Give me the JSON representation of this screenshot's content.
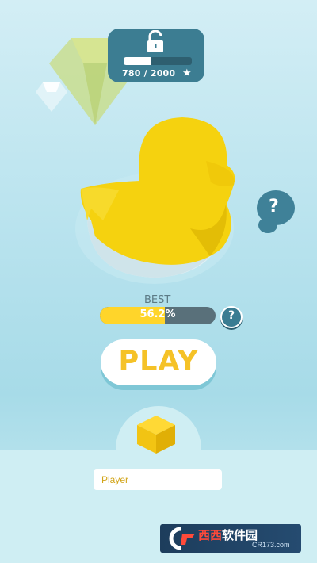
{
  "unlock": {
    "progress_text": "780 / 2000",
    "progress_current": 780,
    "progress_total": 2000,
    "star_icon": "star-icon",
    "lock_icon": "unlocked-padlock-icon"
  },
  "help": {
    "large_label": "?",
    "small_label": "?"
  },
  "best": {
    "label": "BEST",
    "percent_text": "56.2%",
    "percent_value": 56.2
  },
  "play": {
    "label": "PLAY"
  },
  "player": {
    "name_value": "Player"
  },
  "watermark": {
    "brand_red": "西西",
    "brand_white": "软件园",
    "url": "CR173.com"
  },
  "colors": {
    "accent_yellow": "#ffd52a",
    "panel_teal": "#3c7d92",
    "background": "#b9e3ee"
  }
}
